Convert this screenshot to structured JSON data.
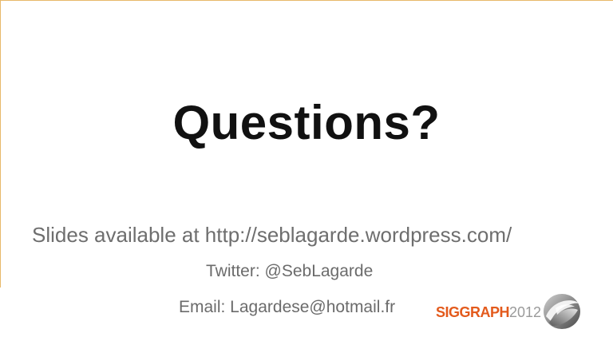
{
  "slide": {
    "title": "Questions?",
    "slides_line": "Slides available at http://seblagarde.wordpress.com/",
    "twitter_line": "Twitter: @SebLagarde",
    "email_line": "Email: Lagardese@hotmail.fr"
  },
  "logo": {
    "word": "SIGGRAPH",
    "year": "2012",
    "brand_color": "#e35a1c",
    "year_color": "#9a9a9a"
  }
}
